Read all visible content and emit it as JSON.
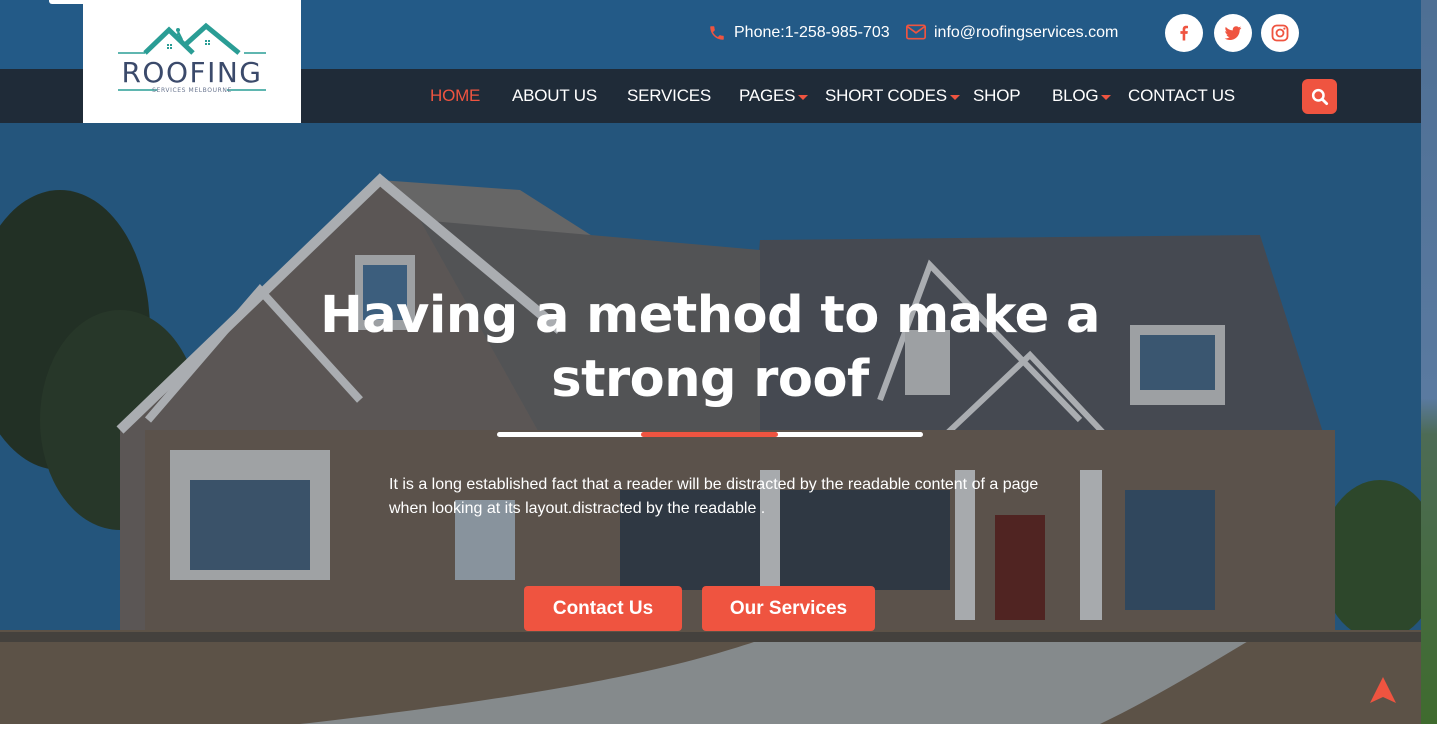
{
  "brand": {
    "name": "ROOFING",
    "tagline": "SERVICES MELBOURNE"
  },
  "topbar": {
    "phone": "Phone:1-258-985-703",
    "email": "info@roofingservices.com",
    "phone_icon": "phone-icon",
    "email_icon": "envelope-icon",
    "social": [
      {
        "name": "facebook",
        "icon": "facebook-icon"
      },
      {
        "name": "twitter",
        "icon": "twitter-icon"
      },
      {
        "name": "instagram",
        "icon": "instagram-icon"
      }
    ]
  },
  "nav": {
    "items": [
      {
        "label": "HOME",
        "active": true,
        "dropdown": false
      },
      {
        "label": "ABOUT US",
        "active": false,
        "dropdown": false
      },
      {
        "label": "SERVICES",
        "active": false,
        "dropdown": false
      },
      {
        "label": "PAGES",
        "active": false,
        "dropdown": true
      },
      {
        "label": "SHORT CODES",
        "active": false,
        "dropdown": true
      },
      {
        "label": "SHOP",
        "active": false,
        "dropdown": false
      },
      {
        "label": "BLOG",
        "active": false,
        "dropdown": true
      },
      {
        "label": "CONTACT US",
        "active": false,
        "dropdown": false
      }
    ],
    "search_icon": "search-icon"
  },
  "hero": {
    "title": "Having a method to make a strong roof",
    "text": "It is a long established fact that a reader will be distracted by the readable content of a page when looking at its layout.distracted by the readable .",
    "buttons": {
      "contact": "Contact Us",
      "services": "Our Services"
    }
  },
  "colors": {
    "accent": "#ef5440",
    "topbar": "#235a87",
    "navbar": "#1f2b38",
    "logo_teal": "#2a9d95",
    "logo_navy": "#3b4a6b"
  }
}
